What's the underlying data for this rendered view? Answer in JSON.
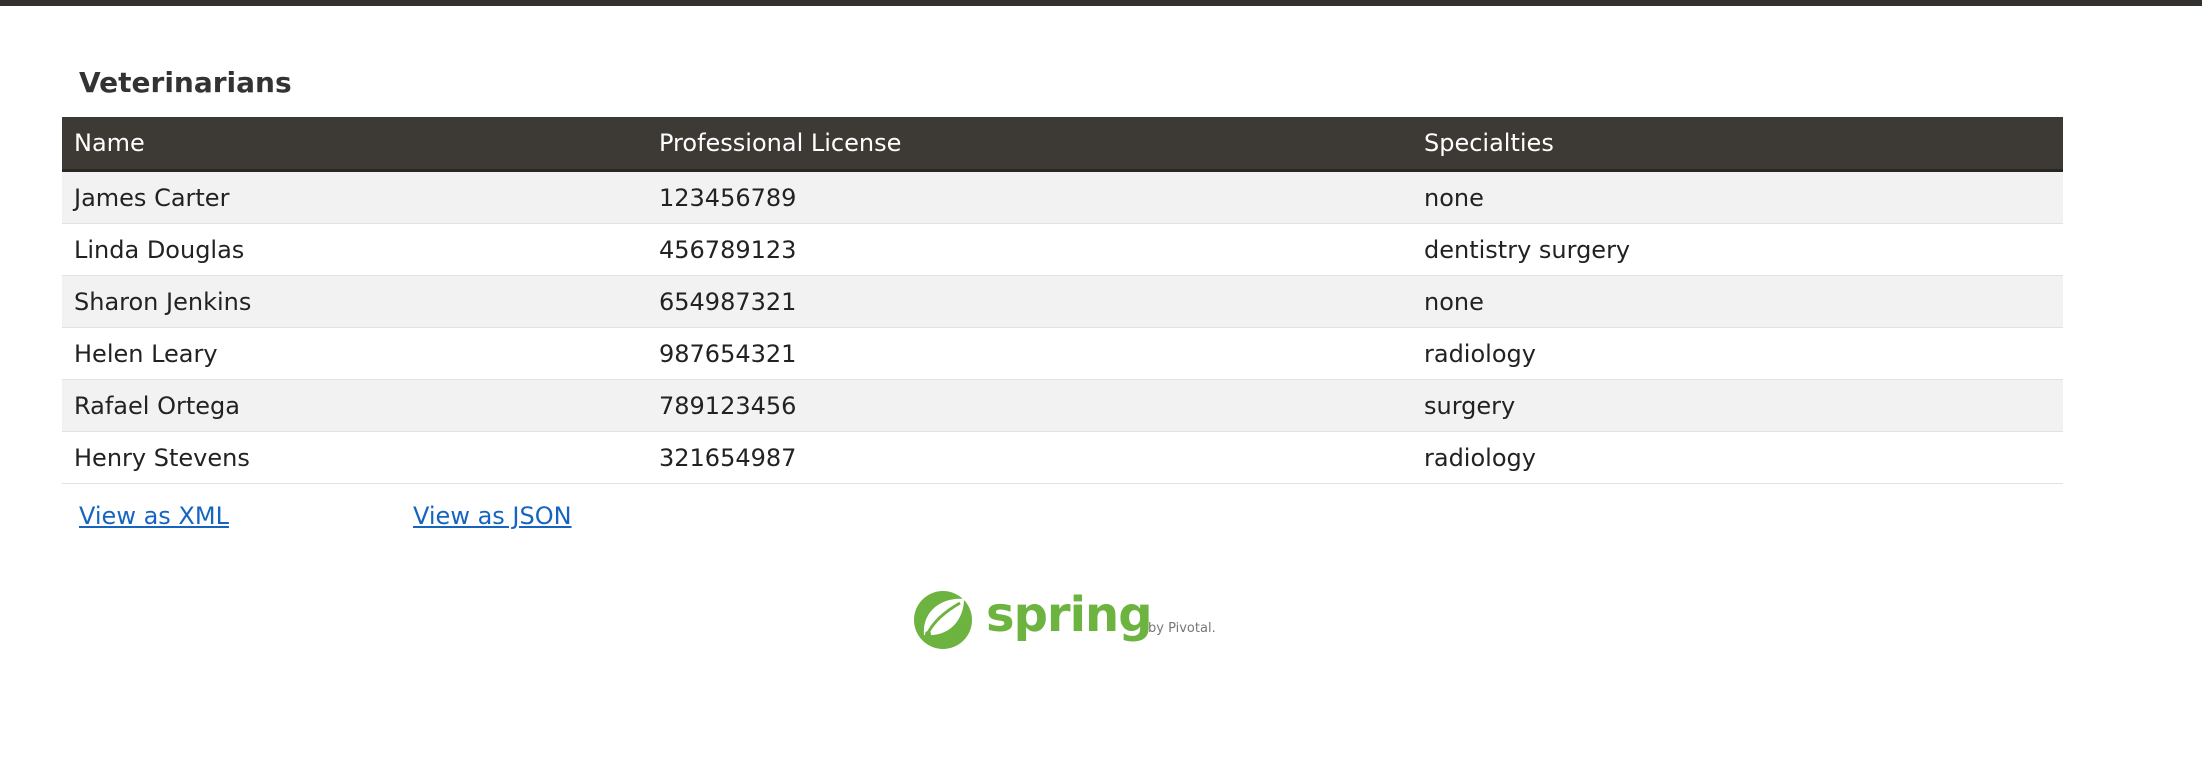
{
  "page": {
    "title": "Veterinarians"
  },
  "table": {
    "headers": [
      "Name",
      "Professional License",
      "Specialties"
    ],
    "rows": [
      [
        "James Carter",
        "123456789",
        "none"
      ],
      [
        "Linda Douglas",
        "456789123",
        "dentistry surgery"
      ],
      [
        "Sharon Jenkins",
        "654987321",
        "none"
      ],
      [
        "Helen Leary",
        "987654321",
        "radiology"
      ],
      [
        "Rafael Ortega",
        "789123456",
        "surgery"
      ],
      [
        "Henry Stevens",
        "321654987",
        "radiology"
      ]
    ]
  },
  "links": {
    "xml": "View as XML",
    "json": "View as JSON"
  },
  "footer": {
    "logo_text": "spring",
    "logo_sub": "by Pivotal.",
    "logo_icon": "spring-leaf-icon"
  },
  "colors": {
    "header_bg": "#3d3934",
    "top_bar": "#34302d",
    "row_alt": "#f2f2f2",
    "link": "#1565c0",
    "spring_green": "#6db33f"
  }
}
